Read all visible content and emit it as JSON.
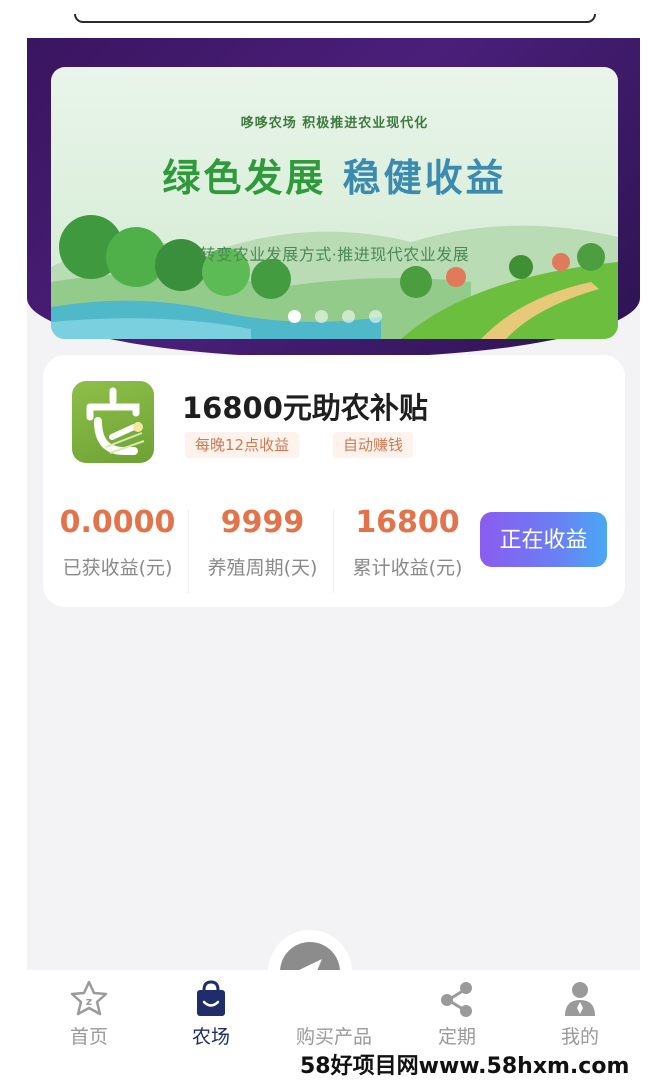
{
  "banner": {
    "subtitle_top": "哆哆农场  积极推进农业现代化",
    "headline_green": "绿色发展",
    "headline_blue": "稳健收益",
    "subtitle_bottom": "转变农业发展方式·推进现代农业发展",
    "slide_count": 4,
    "active_slide": 1
  },
  "product": {
    "title": "16800元助农补贴",
    "logo_icon": "farm-logo-icon",
    "tags": [
      "每晚12点收益",
      "自动赚钱"
    ],
    "stats": [
      {
        "value": "0.0000",
        "label": "已获收益(元)"
      },
      {
        "value": "9999",
        "label": "养殖周期(天)"
      },
      {
        "value": "16800",
        "label": "累计收益(元)"
      }
    ],
    "action_label": "正在收益"
  },
  "tabbar": {
    "items": [
      {
        "label": "首页",
        "icon": "star-icon"
      },
      {
        "label": "农场",
        "icon": "shopping-bag-icon"
      },
      {
        "label": "购买产品",
        "icon": "send-icon"
      },
      {
        "label": "定期",
        "icon": "share-icon"
      },
      {
        "label": "我的",
        "icon": "user-icon"
      }
    ],
    "active_index": 1
  },
  "watermark": "58好项目网www.58hxm.com",
  "colors": {
    "hero": "#3a1560",
    "accent_orange": "#e2734a",
    "button_gradient_start": "#8a5cf0",
    "button_gradient_end": "#4aa8f4",
    "active_tab": "#1f2d6b"
  }
}
